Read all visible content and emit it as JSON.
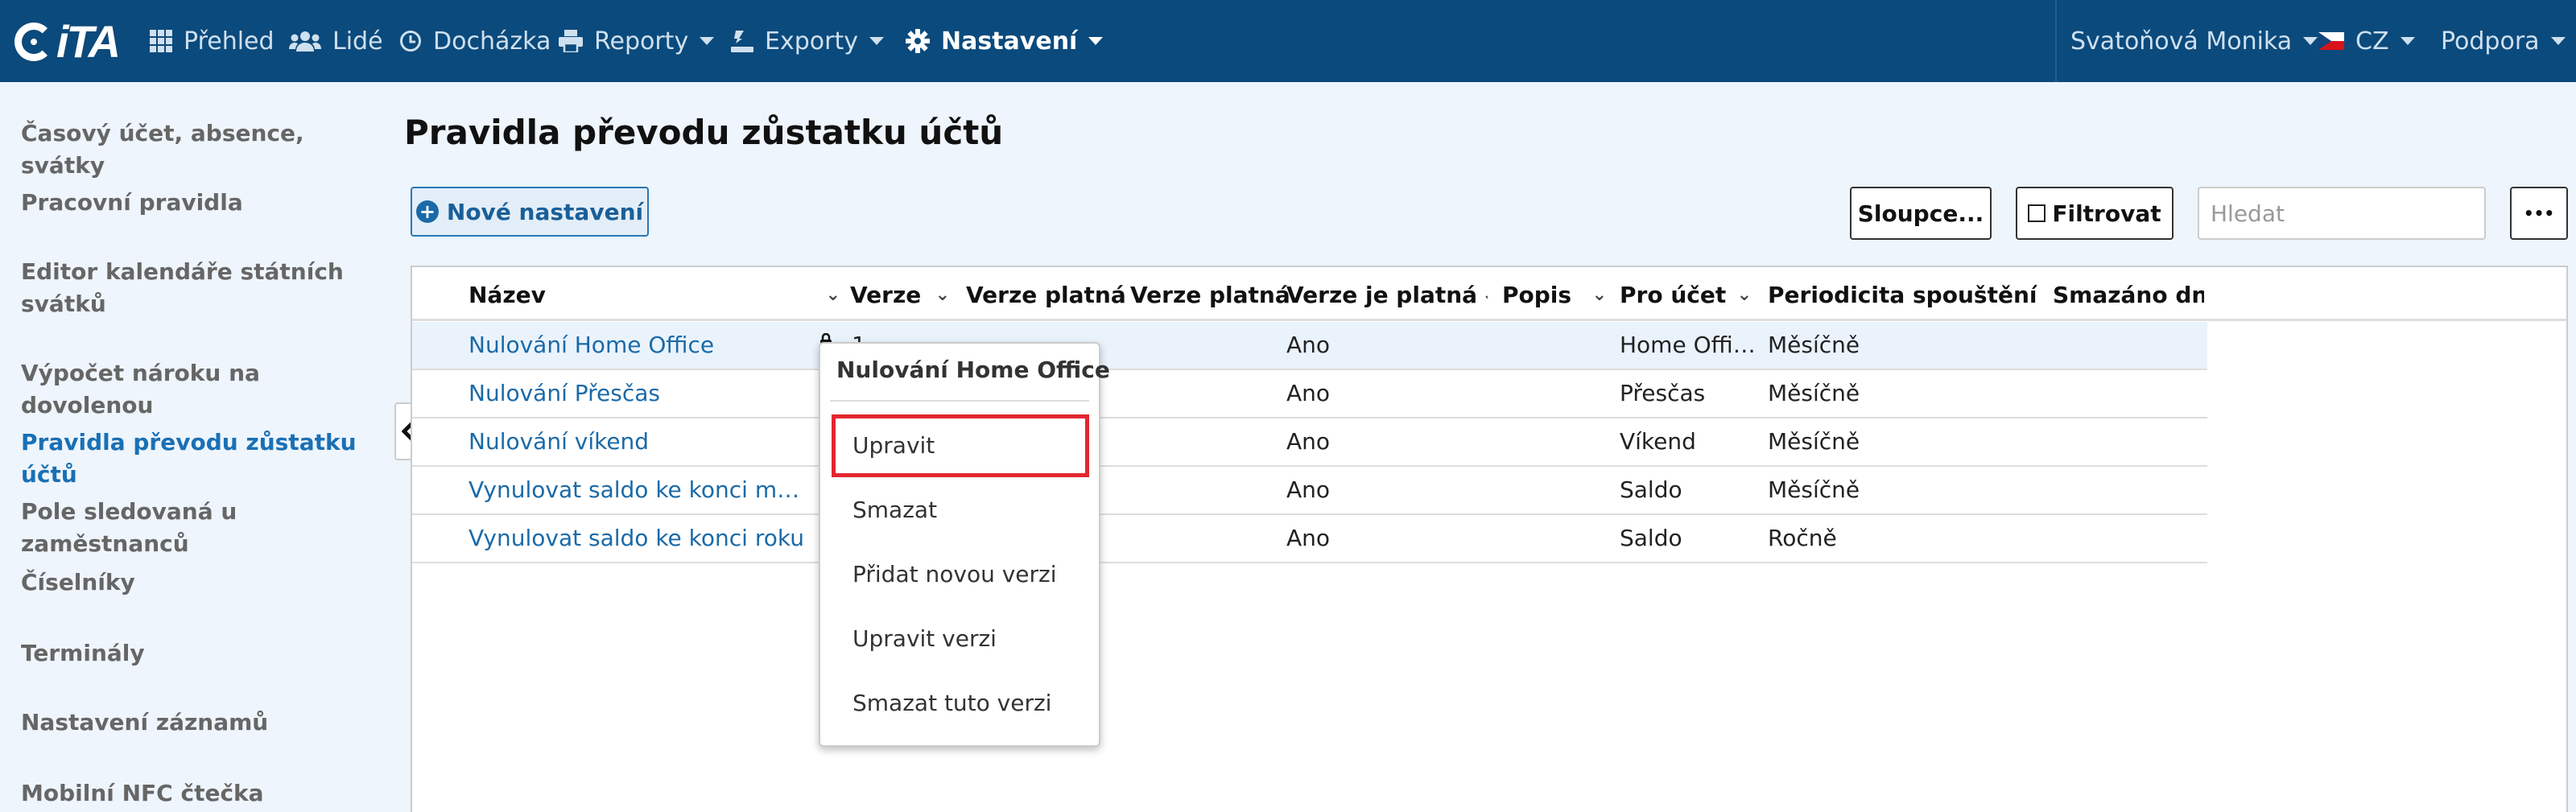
{
  "app": {
    "logo_text": "iTA"
  },
  "nav": {
    "items": [
      {
        "label": "Přehled",
        "icon": "grid-icon"
      },
      {
        "label": "Lidé",
        "icon": "users-icon"
      },
      {
        "label": "Docházka",
        "icon": "clock-icon"
      },
      {
        "label": "Reporty",
        "icon": "print-icon"
      },
      {
        "label": "Exporty",
        "icon": "export-icon"
      },
      {
        "label": "Nastavení",
        "icon": "gear-icon",
        "active": true
      }
    ],
    "user": "Svatoňová Monika",
    "language": "CZ",
    "support": "Podpora"
  },
  "sidebar": {
    "items": [
      {
        "label": "Časový účet, absence, svátky"
      },
      {
        "label": "Pracovní pravidla"
      },
      {
        "label": "Editor kalendáře státních svátků"
      },
      {
        "label": "Výpočet nároku na dovolenou"
      },
      {
        "label": "Pravidla převodu zůstatku účtů",
        "active": true
      },
      {
        "label": "Pole sledovaná u zaměstnanců"
      },
      {
        "label": "Číselníky"
      },
      {
        "label": "Terminály"
      },
      {
        "label": "Nastavení záznamů"
      },
      {
        "label": "Mobilní NFC čtečka"
      }
    ]
  },
  "page": {
    "title": "Pravidla převodu zůstatku účtů",
    "new_button": "Nové nastavení",
    "columns_button": "Sloupce...",
    "filter_button": "Filtrovat",
    "search_placeholder": "Hledat",
    "more_button": "•••"
  },
  "table": {
    "headers": [
      "Název",
      "Verze",
      "Verze platná od",
      "Verze platná do",
      "Verze je platná",
      "Popis",
      "Pro účet",
      "Periodicita spouštění",
      "Smazáno dne"
    ],
    "rows": [
      {
        "name": "Nulování Home Office",
        "version": "1",
        "valid": "Ano",
        "account": "Home Office",
        "period": "Měsíčně"
      },
      {
        "name": "Nulování Přesčas",
        "version": "",
        "valid": "Ano",
        "account": "Přesčas",
        "period": "Měsíčně"
      },
      {
        "name": "Nulování víkend",
        "version": "",
        "valid": "Ano",
        "account": "Víkend",
        "period": "Měsíčně"
      },
      {
        "name": "Vynulovat saldo ke konci měsíce",
        "version": "",
        "valid": "Ano",
        "account": "Saldo",
        "period": "Měsíčně"
      },
      {
        "name": "Vynulovat saldo ke konci roku",
        "version": "",
        "valid": "Ano",
        "account": "Saldo",
        "period": "Ročně"
      }
    ]
  },
  "context_menu": {
    "title": "Nulování Home Office",
    "items": [
      "Upravit",
      "Smazat",
      "Přidat novou verzi",
      "Upravit verzi",
      "Smazat tuto verzi"
    ]
  }
}
